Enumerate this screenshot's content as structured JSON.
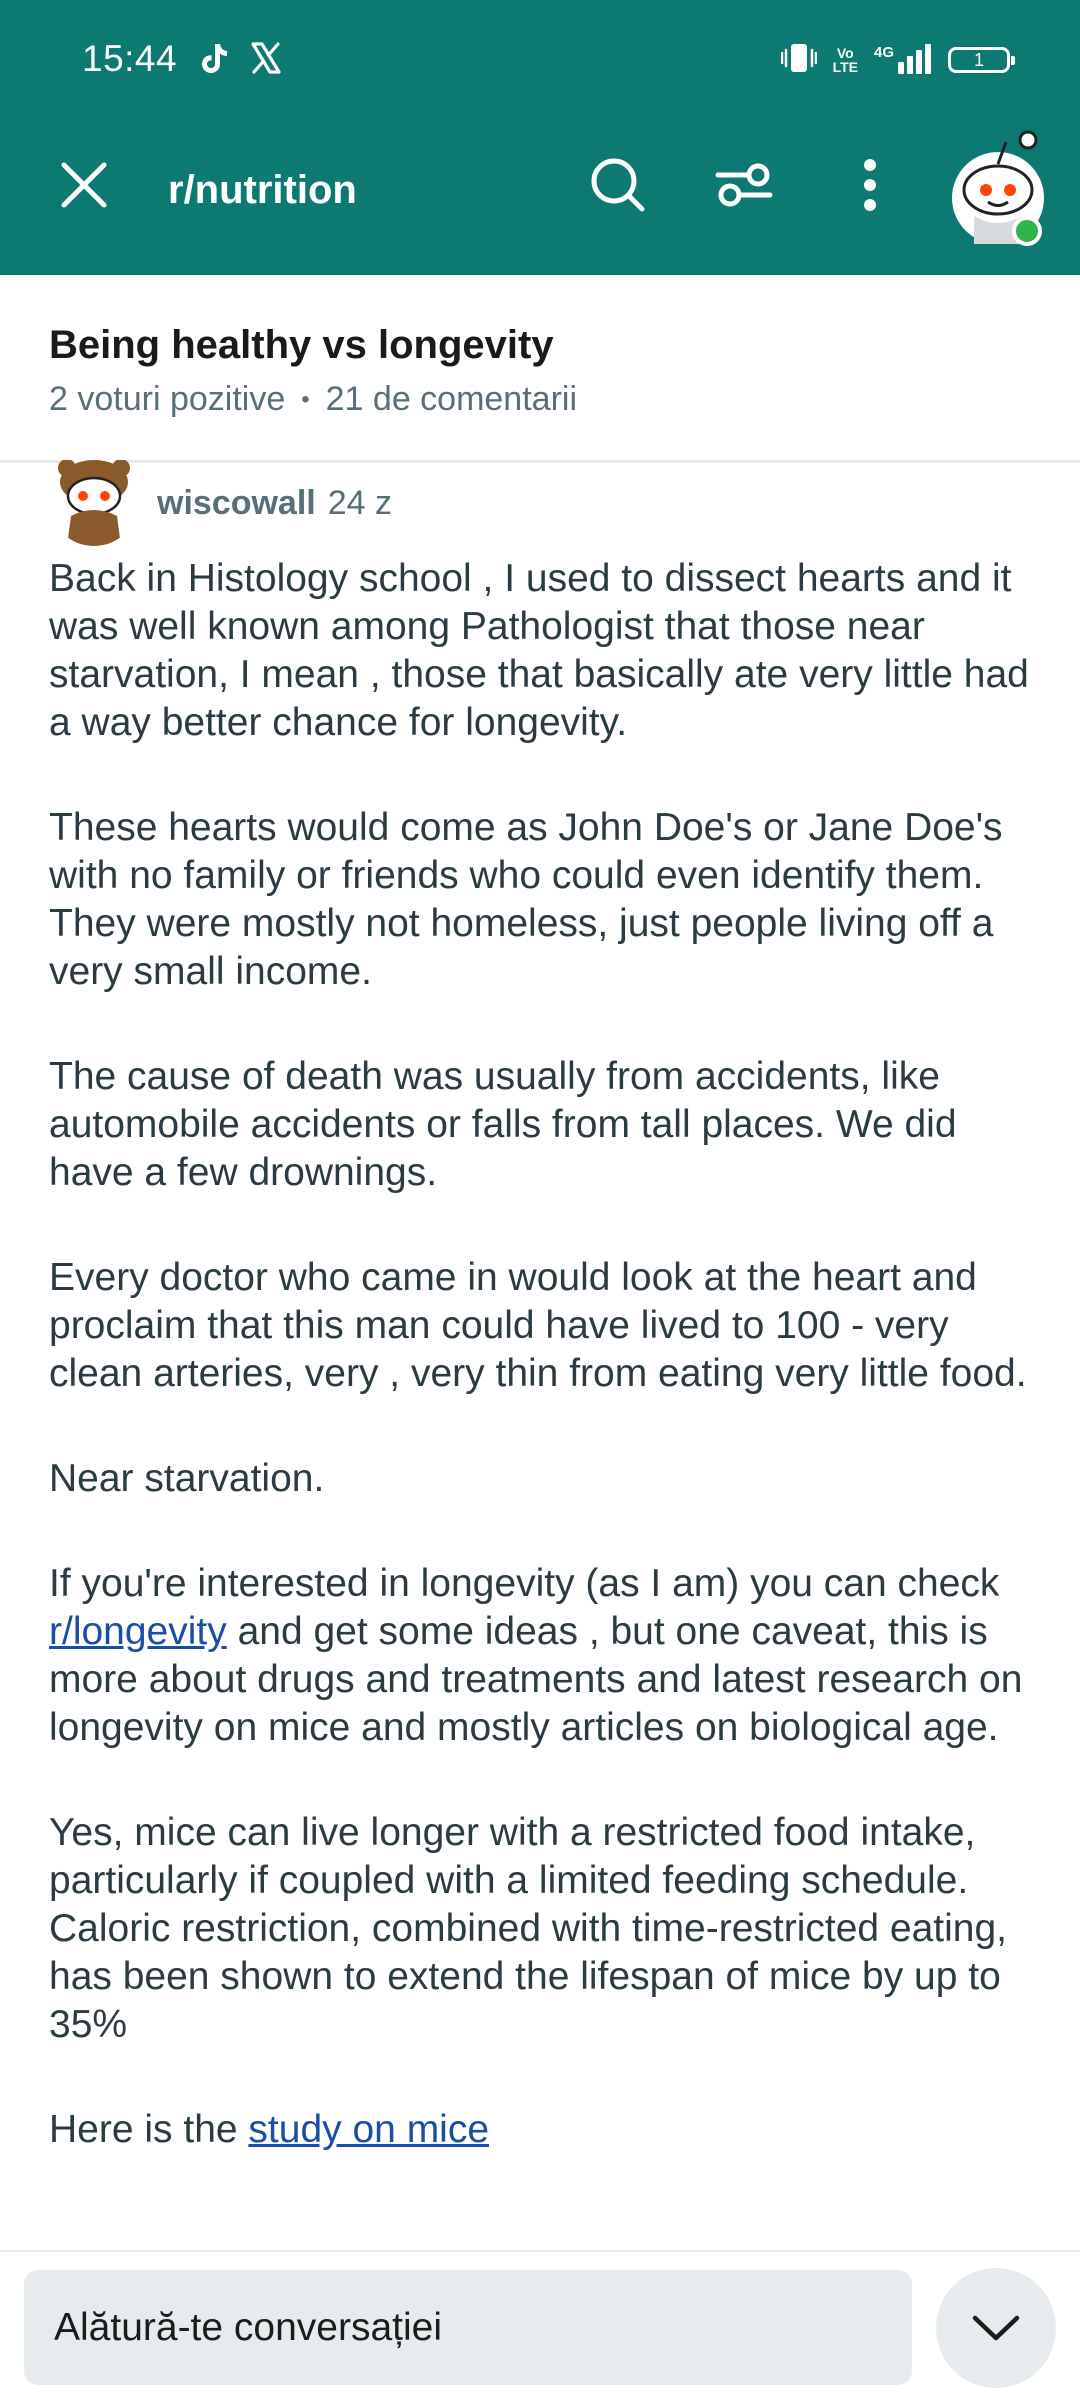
{
  "status_bar": {
    "time": "15:44",
    "app_icons": [
      "tiktok-icon",
      "x-icon"
    ],
    "network_label_top": "Vo",
    "network_label_bottom": "LTE",
    "network_type": "4G",
    "battery_level": "1"
  },
  "header": {
    "subreddit": "r/nutrition",
    "icons": [
      "close-icon",
      "search-icon",
      "filter-icon",
      "more-icon",
      "user-avatar"
    ],
    "accent_color": "#0c7a72"
  },
  "post": {
    "title": "Being healthy vs longevity",
    "upvotes": "2 voturi pozitive",
    "comments": "21 de comentarii"
  },
  "comment": {
    "author": "wiscowall",
    "age": "24 z",
    "paragraphs": {
      "p1": "Back in Histology school , I used to dissect hearts and it was well known among Pathologist that those near starvation, I mean , those that basically ate very little had a way better chance for longevity.",
      "p2": "These hearts would come as John Doe's or Jane Doe's with no family or friends who could even identify them. They were mostly not homeless, just people living off a very small income.",
      "p3": "The cause of death was usually from accidents, like automobile accidents or falls from tall places. We did have a few drownings.",
      "p4": "Every doctor who came in would look at the heart and proclaim that this man could have lived to 100 - very clean arteries, very , very thin from eating very little food.",
      "p5": "Near starvation.",
      "p6_before": "If you're interested in longevity (as I am) you can check ",
      "p6_link": "r/longevity",
      "p6_after": " and get some ideas , but one caveat, this is more about drugs and treatments and latest research on longevity on mice and mostly articles on biological age.",
      "p7": "Yes, mice can live longer with a restricted food intake, particularly if coupled with a limited feeding schedule. Caloric restriction, combined with time-restricted eating, has been shown to extend the lifespan of mice by up to 35%",
      "p8_before": "Here is the ",
      "p8_link": "study on mice"
    }
  },
  "bottom_bar": {
    "join_placeholder": "Alătură-te conversației",
    "collapse_icon": "chevron-down-icon"
  }
}
